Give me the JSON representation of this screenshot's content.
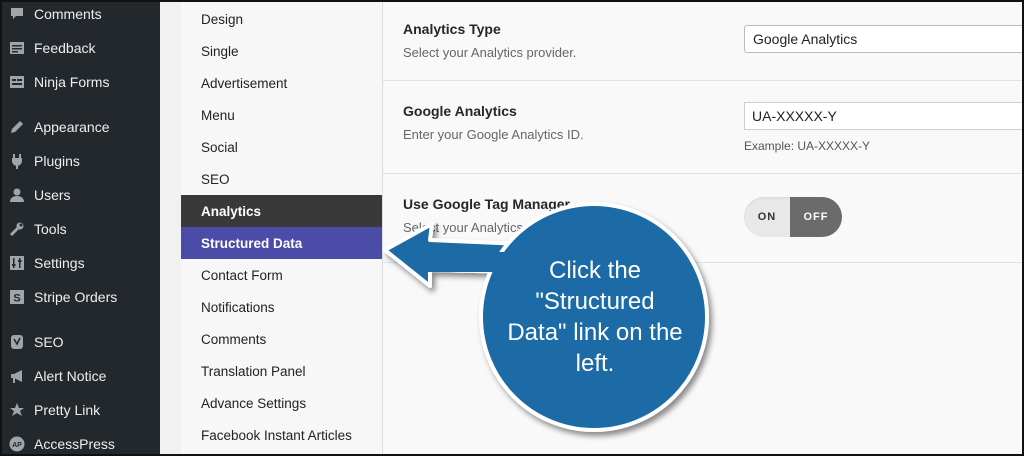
{
  "wp_menu": [
    {
      "label": "Comments",
      "icon": "comments-icon"
    },
    {
      "label": "Feedback",
      "icon": "feedback-icon"
    },
    {
      "label": "Ninja Forms",
      "icon": "forms-icon"
    },
    {
      "label": "Appearance",
      "icon": "appearance-icon"
    },
    {
      "label": "Plugins",
      "icon": "plugins-icon"
    },
    {
      "label": "Users",
      "icon": "users-icon"
    },
    {
      "label": "Tools",
      "icon": "tools-icon"
    },
    {
      "label": "Settings",
      "icon": "settings-icon"
    },
    {
      "label": "Stripe Orders",
      "icon": "stripe-icon"
    },
    {
      "label": "SEO",
      "icon": "seo-icon"
    },
    {
      "label": "Alert Notice",
      "icon": "megaphone-icon"
    },
    {
      "label": "Pretty Link",
      "icon": "star-icon"
    },
    {
      "label": "AccessPress",
      "icon": "ap-icon"
    }
  ],
  "options_nav": [
    {
      "label": "Design"
    },
    {
      "label": "Single"
    },
    {
      "label": "Advertisement"
    },
    {
      "label": "Menu"
    },
    {
      "label": "Social"
    },
    {
      "label": "SEO"
    },
    {
      "label": "Analytics"
    },
    {
      "label": "Structured Data"
    },
    {
      "label": "Contact Form"
    },
    {
      "label": "Notifications"
    },
    {
      "label": "Comments"
    },
    {
      "label": "Translation Panel"
    },
    {
      "label": "Advance Settings"
    },
    {
      "label": "Facebook Instant Articles"
    }
  ],
  "analytics_type": {
    "title": "Analytics Type",
    "description": "Select your Analytics provider.",
    "selected": "Google Analytics"
  },
  "google_analytics": {
    "title": "Google Analytics",
    "description": "Enter your Google Analytics ID.",
    "value": "UA-XXXXX-Y",
    "example": "Example: UA-XXXXX-Y"
  },
  "tag_manager": {
    "title": "Use Google Tag Manager",
    "description": "Select your Analytics pr",
    "toggle_on": "ON",
    "toggle_off": "OFF",
    "state": "off"
  },
  "callout": {
    "text": "Click the \"Structured Data\" link on the left.",
    "color": "#1b6aa6"
  },
  "colors": {
    "wp_sidebar": "#23282d",
    "active_nav": "#4a4ca8",
    "dark_nav": "#393939"
  }
}
